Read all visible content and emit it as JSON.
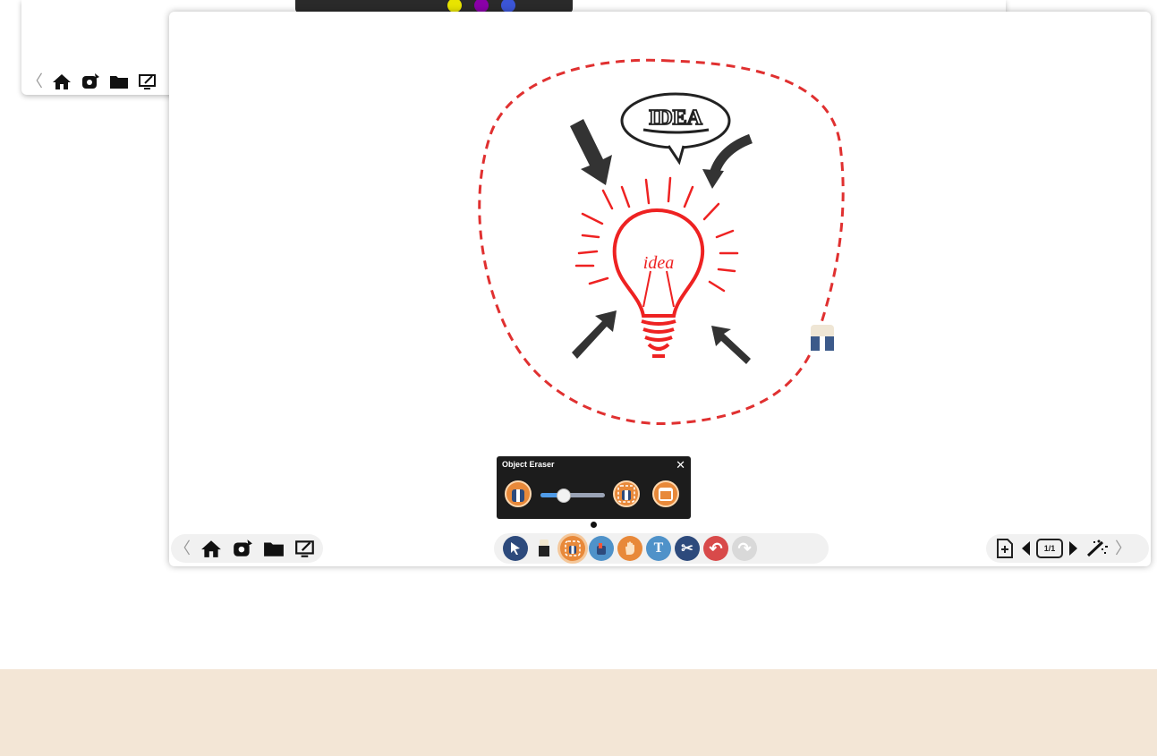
{
  "back_window": {
    "palette_colors": [
      "#e8e400",
      "#8a00a8",
      "#3b55d6"
    ],
    "toolbar_icons": [
      "chevron-left-icon",
      "home-icon",
      "settings-icon",
      "folder-icon",
      "screen-annotate-icon"
    ]
  },
  "main_window": {
    "left_toolbar": {
      "icons": [
        "chevron-left-icon",
        "home-icon",
        "settings-icon",
        "folder-icon",
        "screen-annotate-icon"
      ],
      "chevron": "〈"
    },
    "center_toolbar": {
      "tools": [
        {
          "name": "select-tool",
          "icon": "cursor-icon",
          "color": "#2d4a7c"
        },
        {
          "name": "pen-tool",
          "icon": "marker-icon",
          "color": "#222222"
        },
        {
          "name": "object-eraser-tool",
          "icon": "eraser-icon",
          "color": "#e8893a",
          "selected": true
        },
        {
          "name": "fill-tool",
          "icon": "bucket-icon",
          "color": "#4f92c9"
        },
        {
          "name": "pan-tool",
          "icon": "hand-icon",
          "color": "#e8893a"
        },
        {
          "name": "text-tool",
          "icon": "text-icon",
          "color": "#4f92c9",
          "glyph": "T"
        },
        {
          "name": "cut-tool",
          "icon": "scissors-icon",
          "color": "#2d4a7c",
          "glyph": "✂"
        },
        {
          "name": "undo-tool",
          "icon": "undo-icon",
          "color": "#d84a4a",
          "glyph": "↶"
        },
        {
          "name": "redo-tool",
          "icon": "redo-icon",
          "color": "#d9d9d9",
          "glyph": "↷"
        }
      ]
    },
    "right_toolbar": {
      "page_indicator": "1/1",
      "chevron": "〉"
    },
    "eraser_popup": {
      "title": "Object Eraser",
      "close": "✕",
      "slider_value": 0.35
    },
    "canvas": {
      "speech_bubble_text": "IDEA",
      "bulb_text": "idea",
      "colors": {
        "dashed_outline": "#e03030",
        "bulb": "#ee2222",
        "arrows": "#333333"
      }
    }
  },
  "accent_colors": {
    "orange": "#e8893a",
    "navy": "#2d4a7c",
    "band": "#f3e6d6"
  }
}
